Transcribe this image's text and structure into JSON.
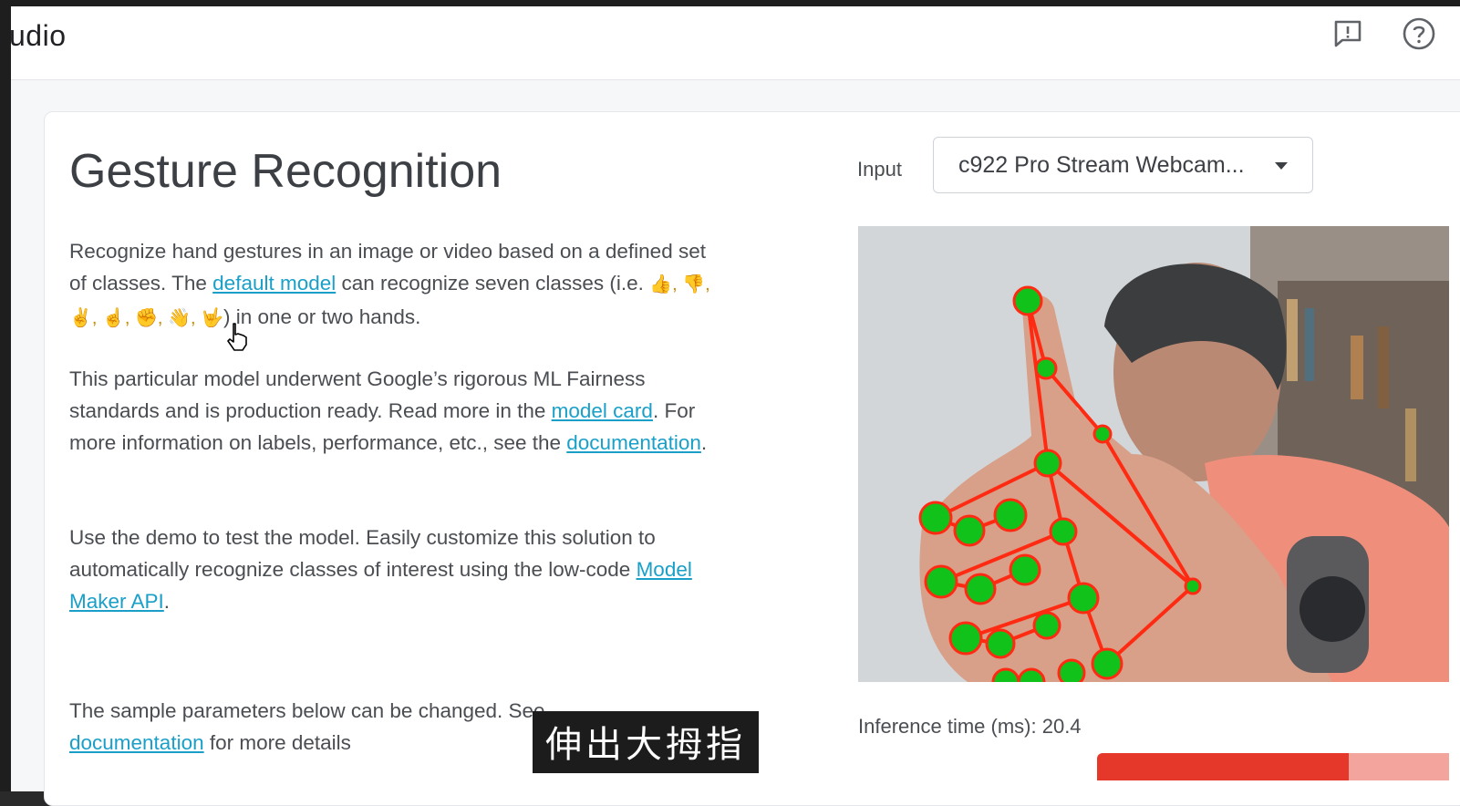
{
  "app": {
    "title_fragment": "udio"
  },
  "header_icons": {
    "feedback": "feedback-icon",
    "help": "help-icon"
  },
  "page": {
    "title": "Gesture Recognition"
  },
  "description": {
    "p1_a": "Recognize hand gestures in an image or video based on a defined set of classes. The ",
    "p1_link": "default model",
    "p1_b": " can recognize seven classes (i.e. ",
    "p1_icons": "👍, 👎, ✌, ☝, ✊, 👋, 🤟",
    "p1_c": ") in one or two hands.",
    "p2_a": "This particular model underwent Google’s rigorous ML Fairness standards and is production ready. Read more in the ",
    "p2_link1": "model card",
    "p2_b": ". For more information on labels, performance, etc., see the ",
    "p2_link2": "documentation",
    "p2_c": ".",
    "p3_a": "Use the demo to test the model. Easily customize this solution to automatically recognize classes of interest using the low-code ",
    "p3_link": "Model Maker API",
    "p3_c": ".",
    "p4_a": "The sample parameters below can be changed. See ",
    "p4_link": "documentation",
    "p4_b": " for more details"
  },
  "input": {
    "label": "Input",
    "selected": "c922 Pro Stream Webcam..."
  },
  "results": {
    "inference": "Inference time (ms): 20.4"
  },
  "subtitle": "伸出大拇指",
  "colors": {
    "link": "#1aa0c8",
    "landmark": "#10c21a",
    "connector": "#ff2a12",
    "score_bar": "#e5382b"
  }
}
